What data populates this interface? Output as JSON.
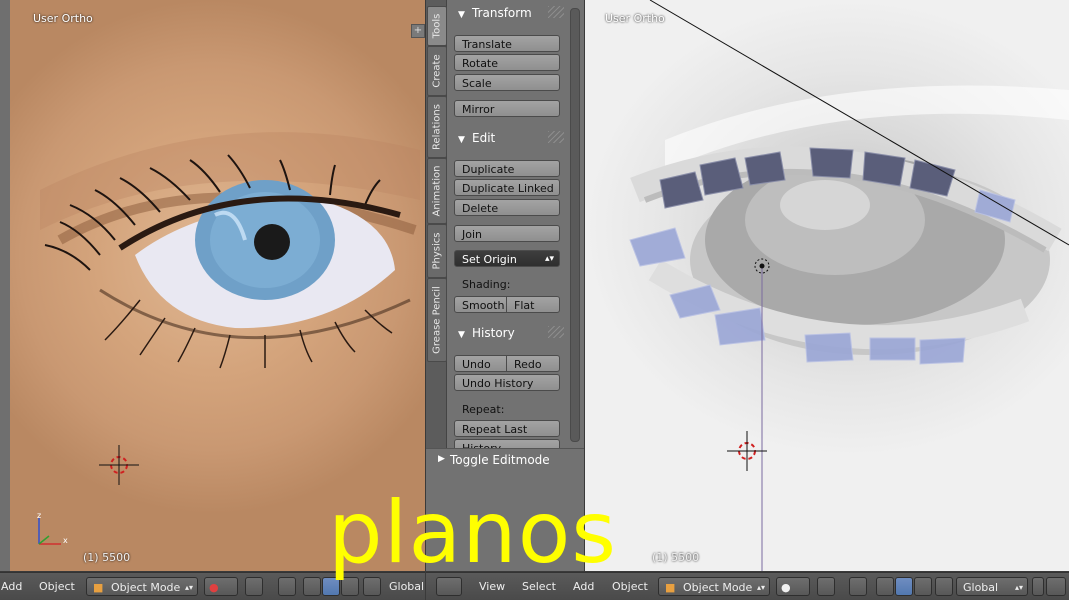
{
  "left_viewport": {
    "label": "User Ortho",
    "frame": "(1) 5500"
  },
  "right_viewport": {
    "label": "User Ortho",
    "frame": "(1) 5500"
  },
  "toolshelf": {
    "tabs": [
      "Tools",
      "Create",
      "Relations",
      "Animation",
      "Physics",
      "Grease Pencil"
    ],
    "transform": {
      "title": "Transform",
      "translate": "Translate",
      "rotate": "Rotate",
      "scale": "Scale",
      "mirror": "Mirror"
    },
    "edit": {
      "title": "Edit",
      "duplicate": "Duplicate",
      "duplicate_linked": "Duplicate Linked",
      "delete": "Delete",
      "join": "Join",
      "set_origin": "Set Origin",
      "shading_label": "Shading:",
      "smooth": "Smooth",
      "flat": "Flat"
    },
    "history": {
      "title": "History",
      "undo": "Undo",
      "redo": "Redo",
      "undo_history": "Undo History",
      "repeat_label": "Repeat:",
      "repeat_last": "Repeat Last",
      "history_cut": "History..."
    },
    "toggle_editmode": "Toggle Editmode"
  },
  "left_header": {
    "add": "Add",
    "object": "Object",
    "mode": "Object Mode",
    "orientation": "Global"
  },
  "right_header": {
    "view": "View",
    "select": "Select",
    "add": "Add",
    "object": "Object",
    "mode": "Object Mode",
    "orientation": "Global"
  },
  "overlay_text": "planos",
  "colors": {
    "overlay": "#ffff00",
    "active_blue": "#5278b0",
    "iris": "#6fa0c8",
    "lash_planes": "#9aa6d6"
  }
}
